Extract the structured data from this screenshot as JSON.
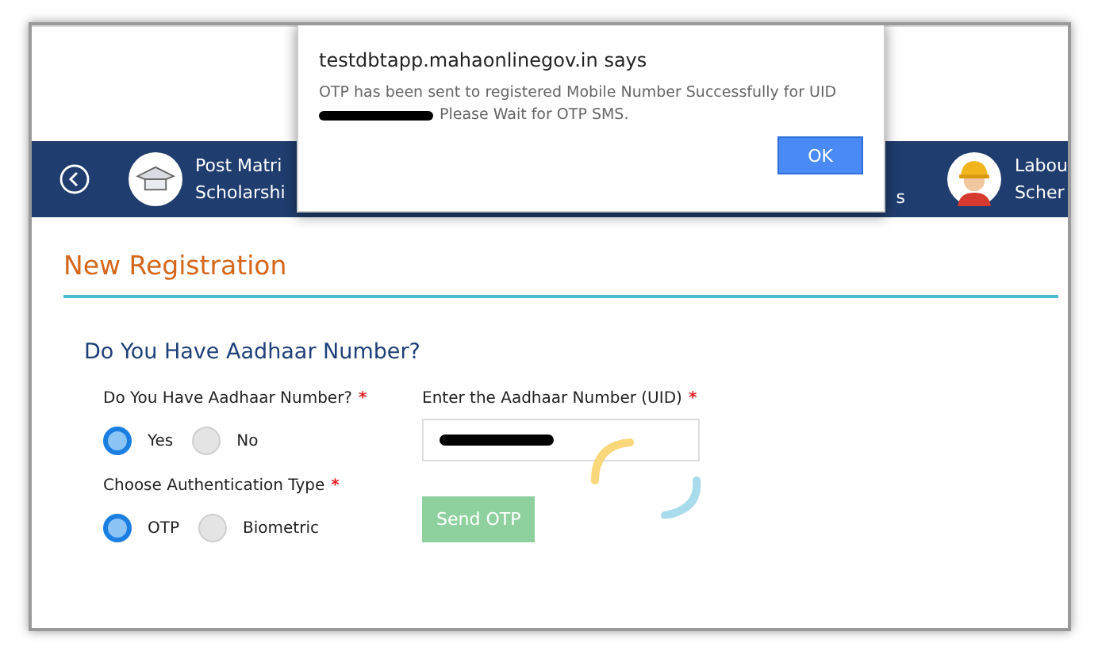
{
  "nav": {
    "items": [
      {
        "kind": "back"
      },
      {
        "kind": "education",
        "line_1": "Post Matri",
        "line_2": "Scholarshi"
      },
      {
        "kind": "fragment",
        "line_2": "s"
      },
      {
        "kind": "labour",
        "line_1": "Labou",
        "line_2": "Scher"
      }
    ]
  },
  "dialog": {
    "title": "testdbtapp.mahaonlinegov.in says",
    "message_1": "OTP has been sent to registered Mobile Number Successfully for UID",
    "message_2": "Please Wait for OTP SMS.",
    "button": "OK"
  },
  "page_title": "New Registration",
  "section_title": "Do You Have Aadhaar Number?",
  "aadhaar_choice": {
    "label": "Do You Have Aadhaar Number?",
    "required_mark": "*",
    "options": [
      {
        "label": "Yes",
        "selected": true
      },
      {
        "label": "No",
        "selected": false
      }
    ]
  },
  "aadhaar_field": {
    "label": "Enter the Aadhaar Number (UID)",
    "required_mark": "*",
    "loading": true
  },
  "auth_type": {
    "label": "Choose Authentication Type",
    "required_mark": "*",
    "options": [
      {
        "label": "OTP",
        "selected": true
      },
      {
        "label": "Biometric",
        "selected": false
      }
    ]
  },
  "send_button": {
    "label": "Send OTP",
    "disabled": true
  }
}
